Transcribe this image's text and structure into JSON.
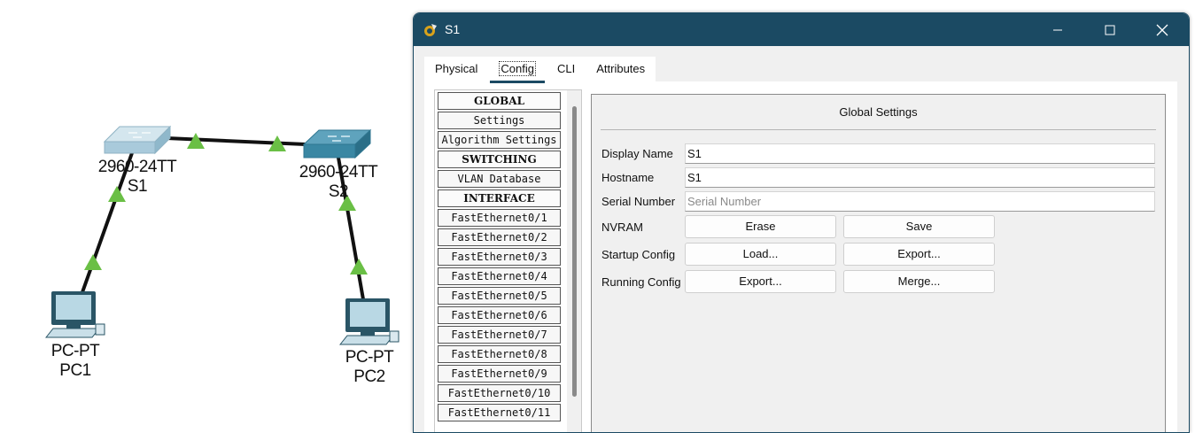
{
  "topology": {
    "devices": [
      {
        "id": "s1",
        "model": "2960-24TT",
        "name": "S1"
      },
      {
        "id": "s2",
        "model": "2960-24TT",
        "name": "S2"
      },
      {
        "id": "pc1",
        "model": "PC-PT",
        "name": "PC1"
      },
      {
        "id": "pc2",
        "model": "PC-PT",
        "name": "PC2"
      }
    ],
    "link_color": "#111111",
    "link_status_color": "#6abf45",
    "switch_colors": {
      "s1": "#b8d6e3",
      "s2": "#3f8ea8"
    }
  },
  "window": {
    "title": "S1",
    "titlebar_color": "#1b4a63",
    "controls": {
      "minimize_icon": "minimize-icon",
      "maximize_icon": "maximize-icon",
      "close_icon": "close-icon"
    }
  },
  "tabs": [
    {
      "label": "Physical",
      "active": false
    },
    {
      "label": "Config",
      "active": true
    },
    {
      "label": "CLI",
      "active": false
    },
    {
      "label": "Attributes",
      "active": false
    }
  ],
  "sidebar": {
    "items": [
      {
        "label": "GLOBAL",
        "header": true
      },
      {
        "label": "Settings",
        "header": false
      },
      {
        "label": "Algorithm Settings",
        "header": false
      },
      {
        "label": "SWITCHING",
        "header": true
      },
      {
        "label": "VLAN Database",
        "header": false
      },
      {
        "label": "INTERFACE",
        "header": true
      },
      {
        "label": "FastEthernet0/1",
        "header": false
      },
      {
        "label": "FastEthernet0/2",
        "header": false
      },
      {
        "label": "FastEthernet0/3",
        "header": false
      },
      {
        "label": "FastEthernet0/4",
        "header": false
      },
      {
        "label": "FastEthernet0/5",
        "header": false
      },
      {
        "label": "FastEthernet0/6",
        "header": false
      },
      {
        "label": "FastEthernet0/7",
        "header": false
      },
      {
        "label": "FastEthernet0/8",
        "header": false
      },
      {
        "label": "FastEthernet0/9",
        "header": false
      },
      {
        "label": "FastEthernet0/10",
        "header": false
      },
      {
        "label": "FastEthernet0/11",
        "header": false
      }
    ]
  },
  "global_settings": {
    "title": "Global Settings",
    "display_name": {
      "label": "Display Name",
      "value": "S1"
    },
    "hostname": {
      "label": "Hostname",
      "value": "S1"
    },
    "serial_number": {
      "label": "Serial Number",
      "value": "",
      "placeholder": "Serial Number"
    },
    "nvram": {
      "label": "NVRAM",
      "erase": "Erase",
      "save": "Save"
    },
    "startup_config": {
      "label": "Startup Config",
      "load": "Load...",
      "export": "Export..."
    },
    "running_config": {
      "label": "Running Config",
      "export": "Export...",
      "merge": "Merge..."
    }
  }
}
